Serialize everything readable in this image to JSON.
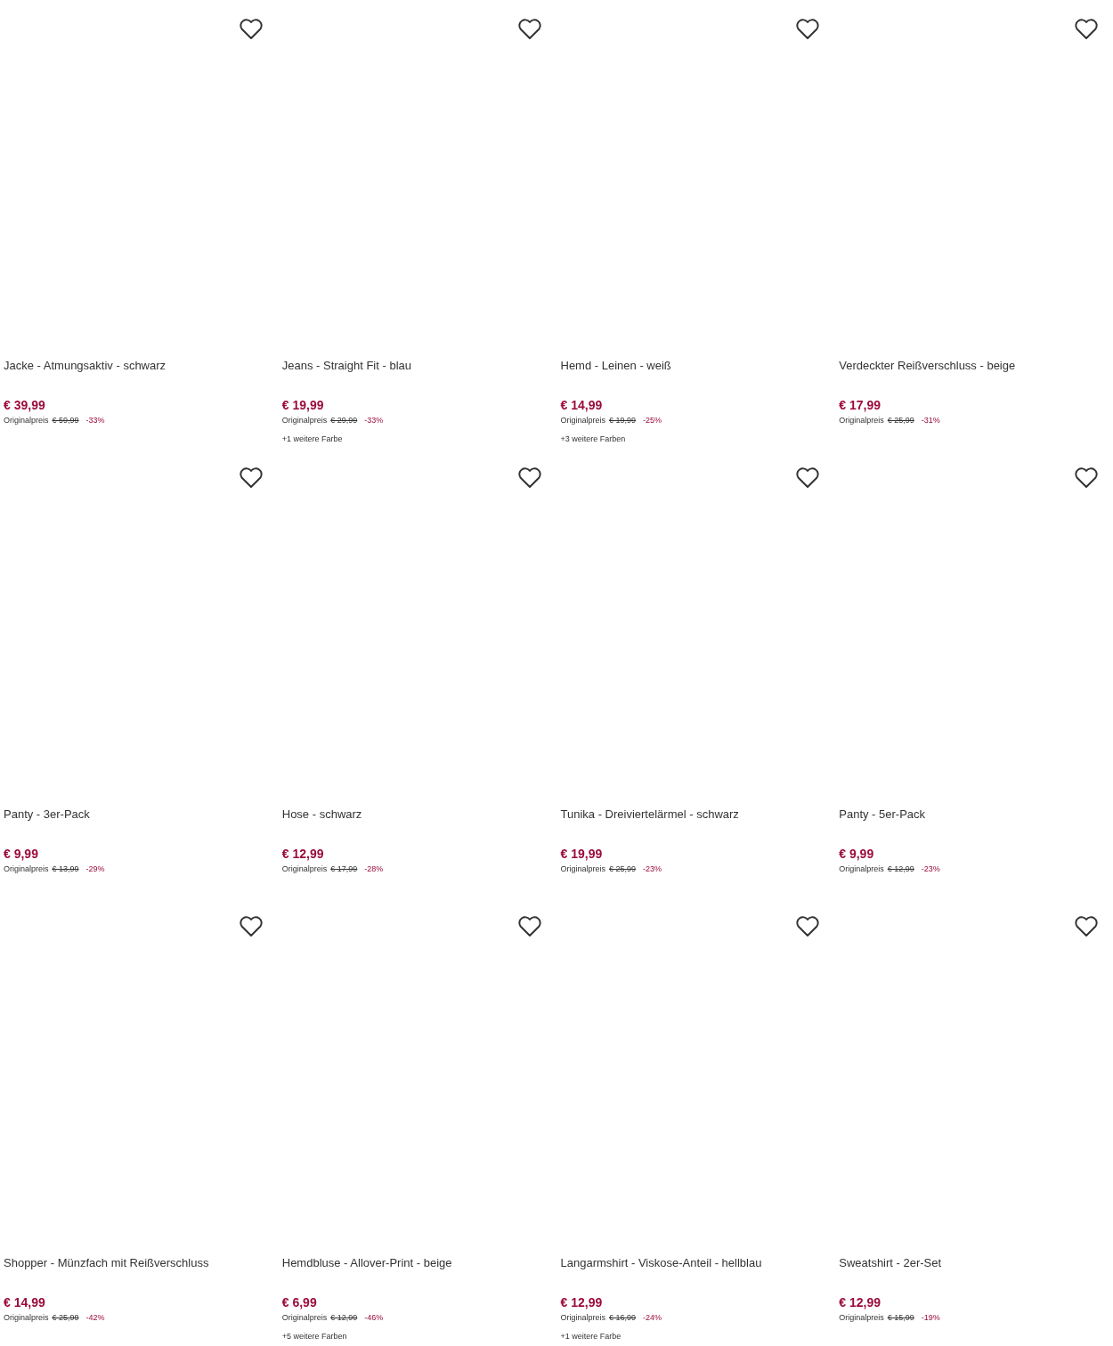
{
  "products": [
    {
      "title": "Jacke - Atmungsaktiv - schwarz",
      "price": "€ 39,99",
      "original_label": "Originalpreis",
      "original_price": "€ 59,99",
      "discount": "-33%"
    },
    {
      "title": "Jeans - Straight Fit - blau",
      "price": "€ 19,99",
      "original_label": "Originalpreis",
      "original_price": "€ 29,99",
      "discount": "-33%",
      "more_colors": "+1 weitere Farbe"
    },
    {
      "title": "Hemd - Leinen - weiß",
      "price": "€ 14,99",
      "original_label": "Originalpreis",
      "original_price": "€ 19,99",
      "discount": "-25%",
      "more_colors": "+3 weitere Farben"
    },
    {
      "title": "Verdeckter Reißverschluss - beige",
      "price": "€ 17,99",
      "original_label": "Originalpreis",
      "original_price": "€ 25,99",
      "discount": "-31%"
    },
    {
      "title": "Panty - 3er-Pack",
      "price": "€ 9,99",
      "original_label": "Originalpreis",
      "original_price": "€ 13,99",
      "discount": "-29%"
    },
    {
      "title": "Hose - schwarz",
      "price": "€ 12,99",
      "original_label": "Originalpreis",
      "original_price": "€ 17,99",
      "discount": "-28%"
    },
    {
      "title": "Tunika - Dreiviertelärmel - schwarz",
      "price": "€ 19,99",
      "original_label": "Originalpreis",
      "original_price": "€ 25,99",
      "discount": "-23%"
    },
    {
      "title": "Panty - 5er-Pack",
      "price": "€ 9,99",
      "original_label": "Originalpreis",
      "original_price": "€ 12,99",
      "discount": "-23%"
    },
    {
      "title": "Shopper - Münzfach mit Reißverschluss",
      "price": "€ 14,99",
      "original_label": "Originalpreis",
      "original_price": "€ 25,99",
      "discount": "-42%"
    },
    {
      "title": "Hemdbluse - Allover-Print - beige",
      "price": "€ 6,99",
      "original_label": "Originalpreis",
      "original_price": "€ 12,99",
      "discount": "-46%",
      "more_colors": "+5 weitere Farben"
    },
    {
      "title": "Langarmshirt - Viskose-Anteil - hellblau",
      "price": "€ 12,99",
      "original_label": "Originalpreis",
      "original_price": "€ 16,99",
      "discount": "-24%",
      "more_colors": "+1 weitere Farbe"
    },
    {
      "title": "Sweatshirt - 2er-Set",
      "price": "€ 12,99",
      "original_label": "Originalpreis",
      "original_price": "€ 15,99",
      "discount": "-19%"
    }
  ]
}
